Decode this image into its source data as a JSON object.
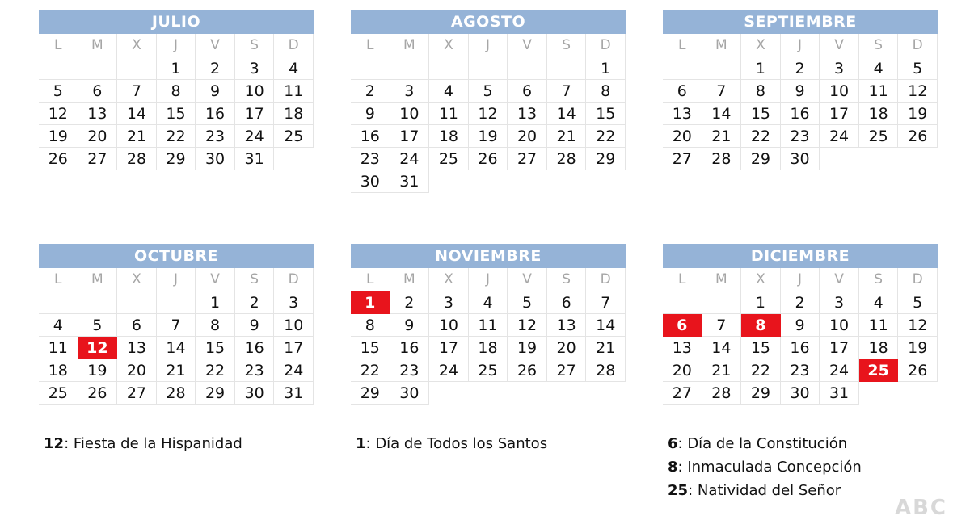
{
  "weekdays": [
    "L",
    "M",
    "X",
    "J",
    "V",
    "S",
    "D"
  ],
  "months": [
    {
      "name": "JULIO",
      "offset": 3,
      "days": 31,
      "holidays": []
    },
    {
      "name": "AGOSTO",
      "offset": 6,
      "days": 31,
      "holidays": []
    },
    {
      "name": "SEPTIEMBRE",
      "offset": 2,
      "days": 30,
      "holidays": []
    },
    {
      "name": "OCTUBRE",
      "offset": 4,
      "days": 31,
      "holidays": [
        12
      ]
    },
    {
      "name": "NOVIEMBRE",
      "offset": 0,
      "days": 30,
      "holidays": [
        1
      ]
    },
    {
      "name": "DICIEMBRE",
      "offset": 2,
      "days": 31,
      "holidays": [
        6,
        8,
        25
      ]
    }
  ],
  "notes": [
    [
      {
        "day": "12",
        "text": ": Fiesta de la Hispanidad"
      }
    ],
    [
      {
        "day": "1",
        "text": ": Día de Todos los Santos"
      }
    ],
    [
      {
        "day": "6",
        "text": ": Día de la Constitución"
      },
      {
        "day": "8",
        "text": ": Inmaculada Concepción"
      },
      {
        "day": "25",
        "text": ": Natividad del Señor"
      }
    ]
  ],
  "colors": {
    "header": "#95b3d7",
    "holiday": "#e8141c",
    "weekday_text": "#a6a6a6"
  },
  "watermark": "ABC"
}
